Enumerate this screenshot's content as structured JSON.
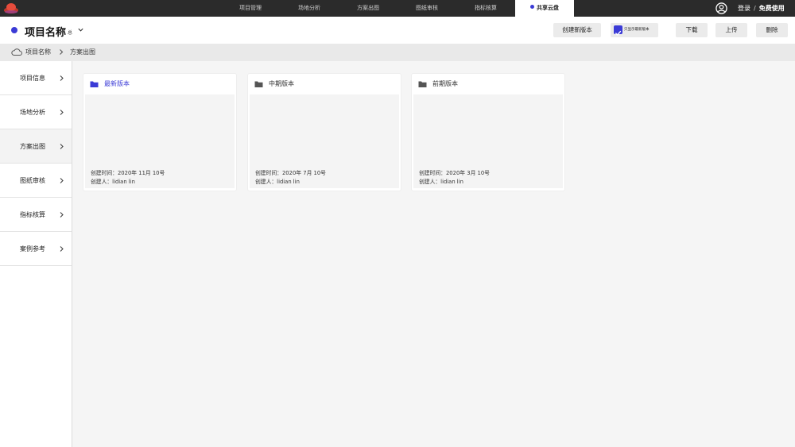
{
  "topnav": {
    "tabs": [
      {
        "label": "项目管理"
      },
      {
        "label": "场地分析"
      },
      {
        "label": "方案出图"
      },
      {
        "label": "图纸审核"
      },
      {
        "label": "指标核算"
      },
      {
        "label": "共享云盘",
        "active": true
      }
    ],
    "login_label": "登录",
    "separator": "/",
    "free_label": "免费使用"
  },
  "header": {
    "project_title": "项目名称",
    "project_sub": "总",
    "buttons": {
      "create_version": "创建新版本",
      "show_latest_only": "只显示最新版本",
      "show_latest_checked": true,
      "download": "下载",
      "upload": "上传",
      "delete": "删除"
    }
  },
  "breadcrumb": {
    "items": [
      "项目名称",
      "方案出图"
    ]
  },
  "sidebar": {
    "items": [
      {
        "label": "项目信息"
      },
      {
        "label": "场地分析"
      },
      {
        "label": "方案出图",
        "active": true
      },
      {
        "label": "图纸审核"
      },
      {
        "label": "指标核算"
      },
      {
        "label": "案例参考"
      }
    ]
  },
  "cards": [
    {
      "title": "最新版本",
      "created_time": "创建时间：2020年 11月 10号",
      "creator": "创建人：lidian lin",
      "selected": true
    },
    {
      "title": "中期版本",
      "created_time": "创建时间：2020年 7月 10号",
      "creator": "创建人：lidian lin"
    },
    {
      "title": "前期版本",
      "created_time": "创建时间：2020年 3月 10号",
      "creator": "创建人：lidian lin"
    }
  ],
  "colors": {
    "accent": "#3b3bd6",
    "topbar": "#2b2b2b",
    "folder_default": "#555555"
  },
  "icons": {
    "logo": "brand-logo",
    "user": "user-circle-icon",
    "cloud": "cloud-icon",
    "folder": "folder-icon",
    "chevron": "chevron-right-icon"
  }
}
